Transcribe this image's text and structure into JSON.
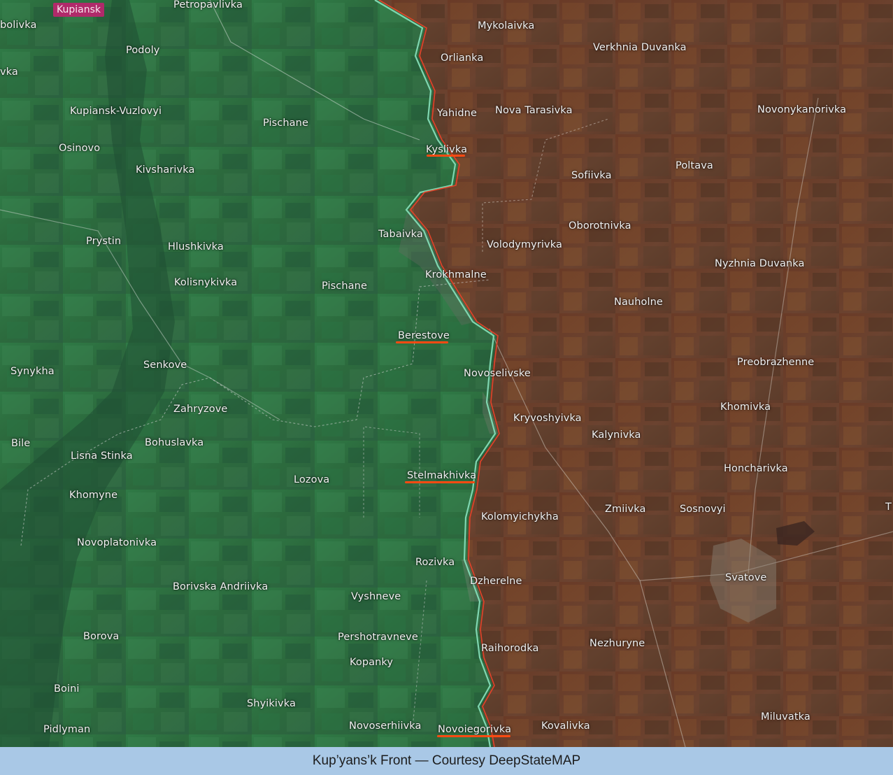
{
  "map": {
    "city_tag": "Kupiansk",
    "labels": [
      {
        "id": "petropavlivka",
        "text": "Petropavlivka"
      },
      {
        "id": "bolivka",
        "text": "bolivka"
      },
      {
        "id": "podoly",
        "text": "Podoly"
      },
      {
        "id": "vka",
        "text": "vka"
      },
      {
        "id": "kupiansk-vuzlovyi",
        "text": "Kupiansk-Vuzlovyi"
      },
      {
        "id": "pischane-1",
        "text": "Pischane"
      },
      {
        "id": "osinovo",
        "text": "Osinovo"
      },
      {
        "id": "kivsharivka",
        "text": "Kivsharivka"
      },
      {
        "id": "prystin",
        "text": "Prystin"
      },
      {
        "id": "hlushkivka",
        "text": "Hlushkivka"
      },
      {
        "id": "kolisnykivka",
        "text": "Kolisnykivka"
      },
      {
        "id": "pischane-2",
        "text": "Pischane"
      },
      {
        "id": "tabaivka",
        "text": "Tabaivka"
      },
      {
        "id": "synykha",
        "text": "Synykha"
      },
      {
        "id": "senkove",
        "text": "Senkove"
      },
      {
        "id": "zahryzove",
        "text": "Zahryzove"
      },
      {
        "id": "bile",
        "text": "Bile"
      },
      {
        "id": "bohuslavka",
        "text": "Bohuslavka"
      },
      {
        "id": "lisna-stinka",
        "text": "Lisna Stinka"
      },
      {
        "id": "lozova",
        "text": "Lozova"
      },
      {
        "id": "khomyne",
        "text": "Khomyne"
      },
      {
        "id": "novoplatonivka",
        "text": "Novoplatonivka"
      },
      {
        "id": "borivska-andriivka",
        "text": "Borivska Andriivka"
      },
      {
        "id": "borova",
        "text": "Borova"
      },
      {
        "id": "boini",
        "text": "Boini"
      },
      {
        "id": "pidlyman",
        "text": "Pidlyman"
      },
      {
        "id": "shyikivka",
        "text": "Shyikivka"
      },
      {
        "id": "novoserhiivka",
        "text": "Novoserhiivka"
      },
      {
        "id": "kopanky",
        "text": "Kopanky"
      },
      {
        "id": "pershotravneve",
        "text": "Pershotravneve"
      },
      {
        "id": "vyshneve",
        "text": "Vyshneve"
      },
      {
        "id": "rozivka",
        "text": "Rozivka"
      },
      {
        "id": "mykolaivka",
        "text": "Mykolaivka"
      },
      {
        "id": "orlianka",
        "text": "Orlianka"
      },
      {
        "id": "verkhnia-duvanka",
        "text": "Verkhnia Duvanka"
      },
      {
        "id": "yahidne",
        "text": "Yahidne"
      },
      {
        "id": "nova-tarasivka",
        "text": "Nova Tarasivka"
      },
      {
        "id": "novonykanorivka",
        "text": "Novonykanorivka"
      },
      {
        "id": "kyslivka",
        "text": "Kyslivka",
        "underlined": true
      },
      {
        "id": "sofiivka",
        "text": "Sofiivka"
      },
      {
        "id": "poltava",
        "text": "Poltava"
      },
      {
        "id": "oborotnivka",
        "text": "Oborotnivka"
      },
      {
        "id": "volodymyrivka",
        "text": "Volodymyrivka"
      },
      {
        "id": "krokhmalne",
        "text": "Krokhmalne"
      },
      {
        "id": "nyzhnia-duvanka",
        "text": "Nyzhnia Duvanka"
      },
      {
        "id": "nauholne",
        "text": "Nauholne"
      },
      {
        "id": "berestove",
        "text": "Berestove",
        "underlined": true
      },
      {
        "id": "novoselivske",
        "text": "Novoselivske"
      },
      {
        "id": "preobrazhenne",
        "text": "Preobrazhenne"
      },
      {
        "id": "khomivka",
        "text": "Khomivka"
      },
      {
        "id": "kryvoshyivka",
        "text": "Kryvoshyivka"
      },
      {
        "id": "kalynivka",
        "text": "Kalynivka"
      },
      {
        "id": "stelmakhivka",
        "text": "Stelmakhivka",
        "underlined": true
      },
      {
        "id": "honcharivka",
        "text": "Honcharivka"
      },
      {
        "id": "kolomyichykha",
        "text": "Kolomyichykha"
      },
      {
        "id": "zmiivka",
        "text": "Zmiivka"
      },
      {
        "id": "sosnovyi",
        "text": "Sosnovyi"
      },
      {
        "id": "t-edge",
        "text": "T"
      },
      {
        "id": "dzherelne",
        "text": "Dzherelne"
      },
      {
        "id": "svatove",
        "text": "Svatove"
      },
      {
        "id": "nezhuryne",
        "text": "Nezhuryne"
      },
      {
        "id": "raihorodka",
        "text": "Raihorodka"
      },
      {
        "id": "miluvatka",
        "text": "Miluvatka"
      },
      {
        "id": "kovalivka",
        "text": "Kovalivka"
      },
      {
        "id": "novoiegorivka",
        "text": "Novoiegorivka",
        "underlined": true
      }
    ],
    "colors": {
      "controlled_area": "#2f6b3e",
      "occupied_area": "#6e3f28",
      "front_line": "#e0442a",
      "contact_line": "#7fd6b0",
      "highlight_underline": "#ff4a12",
      "city_tag": "#b02a6a"
    }
  },
  "caption": "Kup’yans’k Front — Courtesy DeepStateMAP"
}
